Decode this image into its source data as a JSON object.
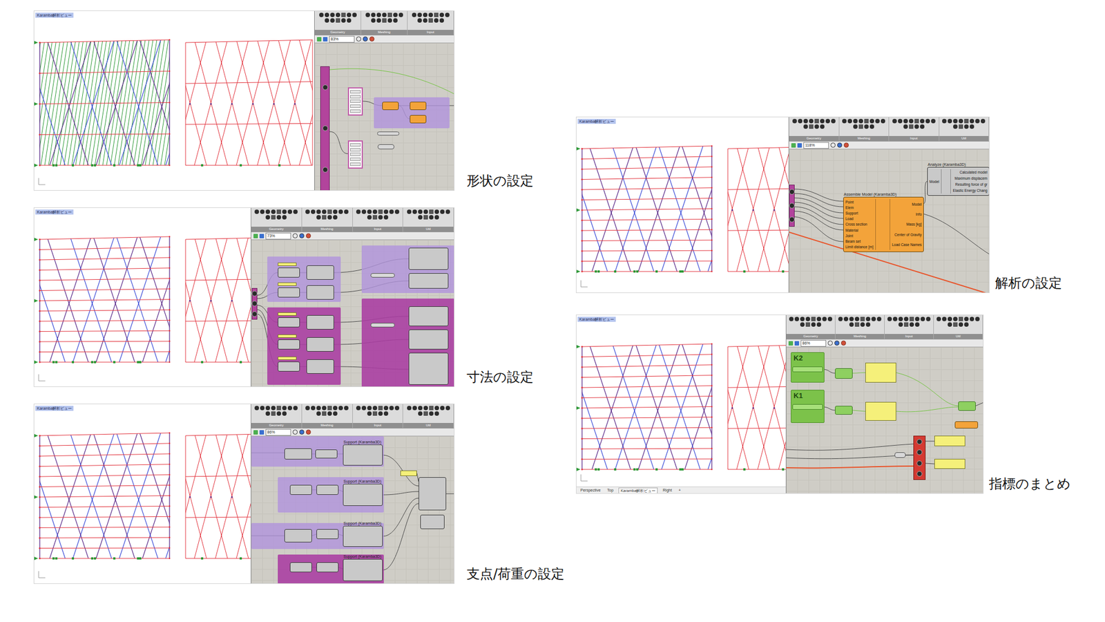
{
  "columns": [
    {
      "panels": [
        {
          "label": "形状の設定",
          "view_title": "Karamba解析ビュー",
          "hatch": true,
          "zoom": "83%",
          "toolbar": [
            "Geometry",
            "Meshing",
            "Input"
          ],
          "nodes": [
            {
              "kind": "strip"
            },
            {
              "kind": "list"
            },
            {
              "kind": "group"
            },
            {
              "kind": "karamba"
            },
            {
              "kind": "karamba"
            },
            {
              "kind": "karamba"
            },
            {
              "kind": "list"
            },
            {
              "kind": "param"
            },
            {
              "kind": "param"
            }
          ]
        },
        {
          "label": "寸法の設定",
          "view_title": "Karamba解析ビュー",
          "hatch": false,
          "zoom": "73%",
          "toolbar": [
            "Geometry",
            "Meshing",
            "Input",
            "Util"
          ],
          "nodes": [
            {
              "kind": "strip"
            },
            {
              "kind": "group"
            },
            {
              "kind": "group-dark"
            },
            {
              "kind": "group"
            },
            {
              "kind": "group-dark"
            },
            {
              "kind": "component"
            },
            {
              "kind": "component"
            },
            {
              "kind": "component"
            },
            {
              "kind": "component"
            },
            {
              "kind": "component"
            },
            {
              "kind": "component"
            },
            {
              "kind": "component"
            },
            {
              "kind": "component"
            },
            {
              "kind": "component"
            },
            {
              "kind": "component"
            },
            {
              "kind": "panel"
            },
            {
              "kind": "panel"
            },
            {
              "kind": "panel"
            },
            {
              "kind": "panel"
            },
            {
              "kind": "panel"
            },
            {
              "kind": "component"
            },
            {
              "kind": "component"
            },
            {
              "kind": "component"
            },
            {
              "kind": "component"
            },
            {
              "kind": "component"
            },
            {
              "kind": "param"
            },
            {
              "kind": "param"
            }
          ]
        },
        {
          "label": "支点/荷重の設定",
          "view_title": "Karamba解析ビュー",
          "hatch": false,
          "zoom": "86%",
          "toolbar": [
            "Geometry",
            "Meshing",
            "Input",
            "Util"
          ],
          "nodes": [
            {
              "kind": "group"
            },
            {
              "kind": "group"
            },
            {
              "kind": "group"
            },
            {
              "kind": "group-dark"
            },
            {
              "kind": "component"
            },
            {
              "kind": "component"
            },
            {
              "kind": "component",
              "title": "Support (Karamba3D)"
            },
            {
              "kind": "component"
            },
            {
              "kind": "component"
            },
            {
              "kind": "component",
              "title": "Support (Karamba3D)"
            },
            {
              "kind": "component"
            },
            {
              "kind": "component"
            },
            {
              "kind": "component",
              "title": "Support (Karamba3D)"
            },
            {
              "kind": "component"
            },
            {
              "kind": "component"
            },
            {
              "kind": "component",
              "title": "Support (Karamba3D)"
            },
            {
              "kind": "panel"
            },
            {
              "kind": "component"
            },
            {
              "kind": "component"
            }
          ]
        }
      ]
    },
    {
      "panels": [
        {
          "label": "解析の設定",
          "view_title": "Karamba解析ビュー",
          "hatch": false,
          "zoom": "118%",
          "toolbar": [
            "Geometry",
            "Meshing",
            "Input",
            "Util"
          ],
          "nodes": [
            {
              "kind": "strip"
            },
            {
              "kind": "karamba",
              "title": "Assemble Model (Karamba3D)",
              "inputs": [
                "Point",
                "Elem",
                "Support",
                "Load",
                "Cross section",
                "Material",
                "Joint",
                "Beam set",
                "Limit distance [m]"
              ],
              "outputs": [
                "Model",
                "Info",
                "Mass [kg]",
                "Center of Gravity",
                "Load Case Names"
              ]
            },
            {
              "kind": "component",
              "title": "Analyze (Karamba3D)",
              "inputs": [
                "Model"
              ],
              "outputs": [
                "Calculated model",
                "Maximum displacem",
                "Resulting force of gr",
                "Elastic Energy Chang"
              ]
            }
          ]
        },
        {
          "label": "指標のまとめ",
          "view_title": "Karamba解析ビュー",
          "hatch": false,
          "zoom": "86%",
          "toolbar": [
            "Geometry",
            "Meshing",
            "Input",
            "Util"
          ],
          "view_tabs": [
            {
              "label": "Perspective",
              "selected": false
            },
            {
              "label": "Top",
              "selected": false
            },
            {
              "label": "Karamba解析ビュー",
              "selected": true
            },
            {
              "label": "Right",
              "selected": false
            },
            {
              "label": "+",
              "selected": false
            }
          ],
          "nodes": [
            {
              "kind": "group-green",
              "text": "K2"
            },
            {
              "kind": "group-green",
              "text": "K1"
            },
            {
              "kind": "slider"
            },
            {
              "kind": "slider"
            },
            {
              "kind": "green"
            },
            {
              "kind": "green"
            },
            {
              "kind": "panel"
            },
            {
              "kind": "panel"
            },
            {
              "kind": "green"
            },
            {
              "kind": "karamba"
            },
            {
              "kind": "redstack"
            },
            {
              "kind": "panel"
            },
            {
              "kind": "panel"
            },
            {
              "kind": "param"
            }
          ]
        }
      ]
    }
  ]
}
